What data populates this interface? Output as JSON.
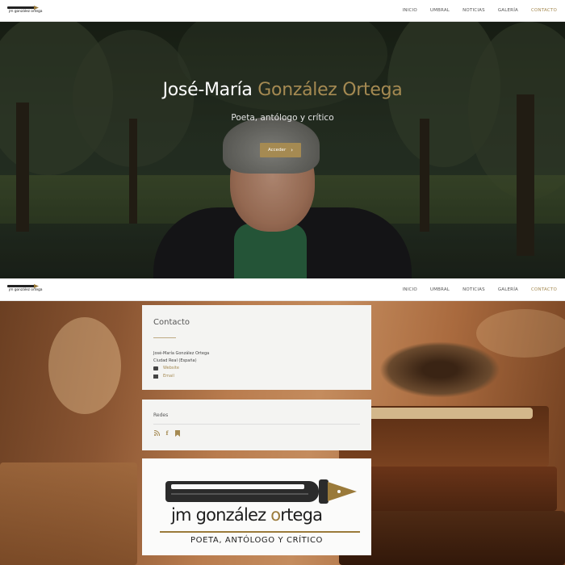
{
  "nav": {
    "logo_text": "jm gonzález ortega",
    "items": [
      {
        "label": "INICIO"
      },
      {
        "label": "UMBRAL"
      },
      {
        "label": "NOTICIAS"
      },
      {
        "label": "GALERÍA"
      },
      {
        "label": "CONTACTO",
        "active": true
      }
    ]
  },
  "hero": {
    "title_first": "José-María",
    "title_accent": "González Ortega",
    "subtitle": "Poeta, antólogo y crítico",
    "button_label": "Acceder",
    "button_icon": "chevron-right-icon"
  },
  "contact": {
    "title": "Contacto",
    "name": "José-María González Ortega",
    "location": "Ciudad Real (España)",
    "website_label": "Website",
    "website_icon": "monitor-icon",
    "email_label": "Email",
    "email_icon": "envelope-icon"
  },
  "social": {
    "title": "Redes",
    "icons": [
      "rss-icon",
      "facebook-icon",
      "bookmark-icon"
    ]
  },
  "brand": {
    "name_before": "jm gonzález ",
    "name_o": "o",
    "name_after": "rtega",
    "tagline": "POETA, ANTÓLOGO Y CRÍTICO"
  },
  "colors": {
    "accent": "#a58a52",
    "nav_text": "#555555",
    "card_bg": "#f4f4f2"
  }
}
